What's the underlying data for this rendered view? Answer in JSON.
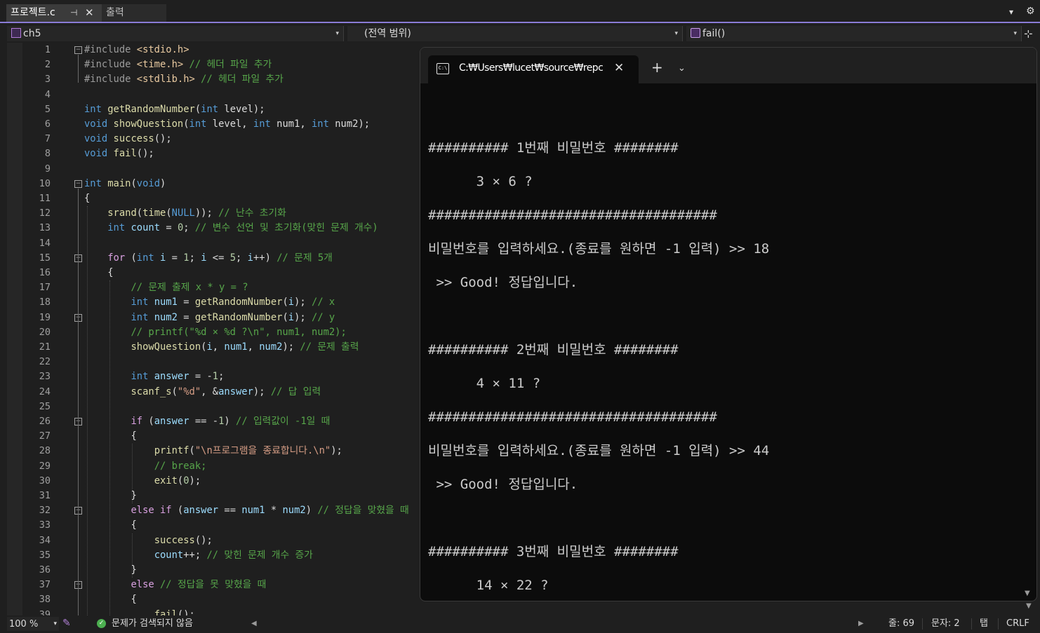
{
  "tabs": {
    "active": "프로젝트.c",
    "other": "출력",
    "pin_glyph": "⊣",
    "close_glyph": "✕",
    "dropdown_glyph": "▾",
    "gear_glyph": "⚙"
  },
  "navbar": {
    "project": "ch5",
    "scope": "(전역 범위)",
    "function": "fail()",
    "arrow": "▾",
    "split_glyph": "⊹"
  },
  "editor": {
    "line_numbers": [
      "1",
      "2",
      "3",
      "4",
      "5",
      "6",
      "7",
      "8",
      "9",
      "10",
      "11",
      "12",
      "13",
      "14",
      "15",
      "16",
      "17",
      "18",
      "19",
      "20",
      "21",
      "22",
      "23",
      "24",
      "25",
      "26",
      "27",
      "28",
      "29",
      "30",
      "31",
      "32",
      "33",
      "34",
      "35",
      "36",
      "37",
      "38",
      "39"
    ],
    "fold_minus": "−",
    "code": [
      [
        [
          "pp",
          "#include "
        ],
        [
          "inc",
          "<stdio.h>"
        ]
      ],
      [
        [
          "pp",
          "#include "
        ],
        [
          "inc",
          "<time.h>"
        ],
        [
          "cm",
          " // 헤더 파일 추가"
        ]
      ],
      [
        [
          "pp",
          "#include "
        ],
        [
          "inc",
          "<stdlib.h>"
        ],
        [
          "cm",
          " // 헤더 파일 추가"
        ]
      ],
      [],
      [
        [
          "kw",
          "int"
        ],
        [
          "",
          " "
        ],
        [
          "fn",
          "getRandomNumber"
        ],
        [
          "",
          "("
        ],
        [
          "kw",
          "int"
        ],
        [
          "",
          " level);"
        ]
      ],
      [
        [
          "kw",
          "void"
        ],
        [
          "",
          " "
        ],
        [
          "fn",
          "showQuestion"
        ],
        [
          "",
          "("
        ],
        [
          "kw",
          "int"
        ],
        [
          "",
          " level, "
        ],
        [
          "kw",
          "int"
        ],
        [
          "",
          " num1, "
        ],
        [
          "kw",
          "int"
        ],
        [
          "",
          " num2);"
        ]
      ],
      [
        [
          "kw",
          "void"
        ],
        [
          "",
          " "
        ],
        [
          "fn",
          "success"
        ],
        [
          "",
          "();"
        ]
      ],
      [
        [
          "kw",
          "void"
        ],
        [
          "",
          " "
        ],
        [
          "fn",
          "fail"
        ],
        [
          "",
          "();"
        ]
      ],
      [],
      [
        [
          "kw",
          "int"
        ],
        [
          "",
          " "
        ],
        [
          "fn",
          "main"
        ],
        [
          "",
          "("
        ],
        [
          "kw",
          "void"
        ],
        [
          "",
          ")"
        ]
      ],
      [
        [
          "",
          "{"
        ]
      ],
      [
        [
          "",
          "    "
        ],
        [
          "fn",
          "srand"
        ],
        [
          "",
          "("
        ],
        [
          "fn",
          "time"
        ],
        [
          "",
          "("
        ],
        [
          "kw",
          "NULL"
        ],
        [
          "",
          "));"
        ],
        [
          "cm",
          " // 난수 초기화"
        ]
      ],
      [
        [
          "",
          "    "
        ],
        [
          "kw",
          "int"
        ],
        [
          "",
          " "
        ],
        [
          "var",
          "count"
        ],
        [
          "",
          " = "
        ],
        [
          "num",
          "0"
        ],
        [
          "",
          ";"
        ],
        [
          "cm",
          " // 변수 선언 및 초기화(맞힌 문제 개수)"
        ]
      ],
      [],
      [
        [
          "",
          "    "
        ],
        [
          "ctl",
          "for"
        ],
        [
          "",
          " ("
        ],
        [
          "kw",
          "int"
        ],
        [
          "",
          " "
        ],
        [
          "var",
          "i"
        ],
        [
          "",
          " = "
        ],
        [
          "num",
          "1"
        ],
        [
          "",
          "; "
        ],
        [
          "var",
          "i"
        ],
        [
          "",
          " <= "
        ],
        [
          "num",
          "5"
        ],
        [
          "",
          "; "
        ],
        [
          "var",
          "i"
        ],
        [
          "",
          "++)"
        ],
        [
          "cm",
          " // 문제 5개"
        ]
      ],
      [
        [
          "",
          "    {"
        ]
      ],
      [
        [
          "",
          "        "
        ],
        [
          "cm",
          "// 문제 출제 x * y = ?"
        ]
      ],
      [
        [
          "",
          "        "
        ],
        [
          "kw",
          "int"
        ],
        [
          "",
          " "
        ],
        [
          "var",
          "num1"
        ],
        [
          "",
          " = "
        ],
        [
          "fn",
          "getRandomNumber"
        ],
        [
          "",
          "("
        ],
        [
          "var",
          "i"
        ],
        [
          "",
          ");"
        ],
        [
          "cm",
          " // x"
        ]
      ],
      [
        [
          "",
          "        "
        ],
        [
          "kw",
          "int"
        ],
        [
          "",
          " "
        ],
        [
          "var",
          "num2"
        ],
        [
          "",
          " = "
        ],
        [
          "fn",
          "getRandomNumber"
        ],
        [
          "",
          "("
        ],
        [
          "var",
          "i"
        ],
        [
          "",
          ");"
        ],
        [
          "cm",
          " // y"
        ]
      ],
      [
        [
          "",
          "        "
        ],
        [
          "cm",
          "// printf(\"%d × %d ?\\n\", num1, num2);"
        ]
      ],
      [
        [
          "",
          "        "
        ],
        [
          "fn",
          "showQuestion"
        ],
        [
          "",
          "("
        ],
        [
          "var",
          "i"
        ],
        [
          "",
          ", "
        ],
        [
          "var",
          "num1"
        ],
        [
          "",
          ", "
        ],
        [
          "var",
          "num2"
        ],
        [
          "",
          ");"
        ],
        [
          "cm",
          " // 문제 출력"
        ]
      ],
      [],
      [
        [
          "",
          "        "
        ],
        [
          "kw",
          "int"
        ],
        [
          "",
          " "
        ],
        [
          "var",
          "answer"
        ],
        [
          "",
          " = -"
        ],
        [
          "num",
          "1"
        ],
        [
          "",
          ";"
        ]
      ],
      [
        [
          "",
          "        "
        ],
        [
          "fn",
          "scanf_s"
        ],
        [
          "",
          "("
        ],
        [
          "str",
          "\"%d\""
        ],
        [
          "",
          ", &"
        ],
        [
          "var",
          "answer"
        ],
        [
          "",
          ");"
        ],
        [
          "cm",
          " // 답 입력"
        ]
      ],
      [],
      [
        [
          "",
          "        "
        ],
        [
          "ctl",
          "if"
        ],
        [
          "",
          " ("
        ],
        [
          "var",
          "answer"
        ],
        [
          "",
          " == -"
        ],
        [
          "num",
          "1"
        ],
        [
          "",
          ")"
        ],
        [
          "cm",
          " // 입력값이 -1일 때"
        ]
      ],
      [
        [
          "",
          "        {"
        ]
      ],
      [
        [
          "",
          "            "
        ],
        [
          "fn",
          "printf"
        ],
        [
          "",
          "("
        ],
        [
          "str",
          "\"\\n프로그램을 종료합니다.\\n\""
        ],
        [
          "",
          ");"
        ]
      ],
      [
        [
          "",
          "            "
        ],
        [
          "cm",
          "// break;"
        ]
      ],
      [
        [
          "",
          "            "
        ],
        [
          "fn",
          "exit"
        ],
        [
          "",
          "("
        ],
        [
          "num",
          "0"
        ],
        [
          "",
          ");"
        ]
      ],
      [
        [
          "",
          "        }"
        ]
      ],
      [
        [
          "",
          "        "
        ],
        [
          "ctl",
          "else if"
        ],
        [
          "",
          " ("
        ],
        [
          "var",
          "answer"
        ],
        [
          "",
          " == "
        ],
        [
          "var",
          "num1"
        ],
        [
          "",
          " * "
        ],
        [
          "var",
          "num2"
        ],
        [
          "",
          ")"
        ],
        [
          "cm",
          " // 정답을 맞혔을 때"
        ]
      ],
      [
        [
          "",
          "        {"
        ]
      ],
      [
        [
          "",
          "            "
        ],
        [
          "fn",
          "success"
        ],
        [
          "",
          "();"
        ]
      ],
      [
        [
          "",
          "            "
        ],
        [
          "var",
          "count"
        ],
        [
          "",
          "++;"
        ],
        [
          "cm",
          " // 맞힌 문제 개수 증가"
        ]
      ],
      [
        [
          "",
          "        }"
        ]
      ],
      [
        [
          "",
          "        "
        ],
        [
          "ctl",
          "else"
        ],
        [
          "cm",
          " // 정답을 못 맞혔을 때"
        ]
      ],
      [
        [
          "",
          "        {"
        ]
      ],
      [
        [
          "",
          "            "
        ],
        [
          "fn",
          "fail"
        ],
        [
          "",
          "();"
        ]
      ]
    ]
  },
  "console": {
    "tab_title": "C:₩Users₩lucet₩source₩repc",
    "icon_text": "C:\\",
    "close_glyph": "✕",
    "new_tab_glyph": "+",
    "dropdown_glyph": "⌄",
    "lines": [
      "########## 1번째 비밀번호 ########",
      "      3 × 6 ?",
      "####################################",
      "비밀번호를 입력하세요.(종료를 원하면 -1 입력) >> 18",
      " >> Good! 정답입니다.",
      "########## 2번째 비밀번호 ########",
      "      4 × 11 ?",
      "####################################",
      "비밀번호를 입력하세요.(종료를 원하면 -1 입력) >> 44",
      " >> Good! 정답입니다.",
      "########## 3번째 비밀번호 ########",
      "      14 × 22 ?"
    ]
  },
  "statusbar": {
    "zoom": "100 %",
    "issues": "문제가 검색되지 않음",
    "line": "줄: 69",
    "col": "문자: 2",
    "tabs": "탭",
    "eol": "CRLF",
    "ok_glyph": "✓",
    "brush_glyph": "✎",
    "left_glyph": "◀",
    "right_glyph": "▶"
  },
  "colors": {
    "accent": "#8a7bd6",
    "editor_bg": "#1f1f1f",
    "console_bg": "#0c0c0c",
    "keyword": "#569cd6",
    "comment": "#57a64a",
    "function": "#dcdcaa"
  }
}
